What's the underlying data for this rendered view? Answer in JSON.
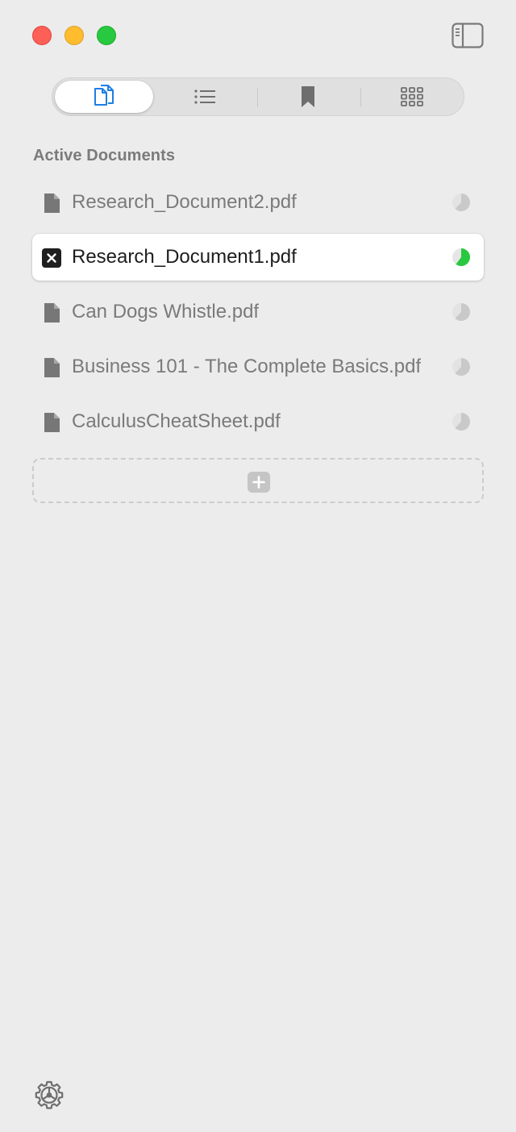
{
  "window": {
    "controls": [
      "close",
      "minimize",
      "zoom"
    ]
  },
  "toolbar": {
    "sidebar_toggle_icon": "sidebar-icon",
    "tabs": [
      {
        "name": "documents",
        "icon": "documents-icon",
        "active": true
      },
      {
        "name": "outline",
        "icon": "list-icon",
        "active": false
      },
      {
        "name": "bookmarks",
        "icon": "bookmark-icon",
        "active": false
      },
      {
        "name": "thumbnails",
        "icon": "grid-icon",
        "active": false
      }
    ]
  },
  "section": {
    "title": "Active Documents"
  },
  "documents": [
    {
      "name": "Research_Document2.pdf",
      "selected": false,
      "icon": "document-icon",
      "progress": 0.62,
      "progress_color": "#c9c9c9"
    },
    {
      "name": "Research_Document1.pdf",
      "selected": true,
      "icon": "close-icon",
      "progress": 0.6,
      "progress_color": "#28c840"
    },
    {
      "name": "Can Dogs Whistle.pdf",
      "selected": false,
      "icon": "document-icon",
      "progress": 0.62,
      "progress_color": "#c9c9c9"
    },
    {
      "name": "Business 101 - The Complete Basics.pdf",
      "selected": false,
      "icon": "document-icon",
      "progress": 0.62,
      "progress_color": "#c9c9c9"
    },
    {
      "name": "CalculusCheatSheet.pdf",
      "selected": false,
      "icon": "document-icon",
      "progress": 0.62,
      "progress_color": "#c9c9c9"
    }
  ],
  "add_document": {
    "icon": "plus-icon"
  },
  "footer": {
    "settings_icon": "gear-icon"
  },
  "colors": {
    "accent": "#1d7fe3",
    "background": "#ececec",
    "progress_active": "#28c840",
    "progress_inactive": "#c9c9c9"
  }
}
